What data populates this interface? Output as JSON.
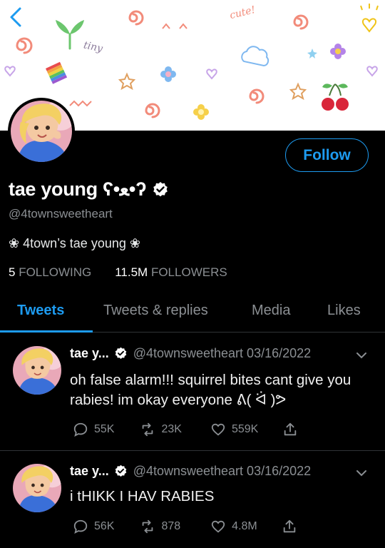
{
  "banner": {
    "doodle_words": [
      "tiny",
      "cute!",
      "^ ^"
    ]
  },
  "profile": {
    "display_name": "tae young ʕ•ﻌ•ʔ",
    "handle": "@4townsweetheart",
    "bio": "❀ 4town’s tae young ❀",
    "following_count": "5",
    "following_label": "FOLLOWING",
    "followers_count": "11.5M",
    "followers_label": "FOLLOWERS",
    "follow_label": "Follow"
  },
  "tabs": [
    {
      "label": "Tweets",
      "active": true
    },
    {
      "label": "Tweets & replies",
      "active": false
    },
    {
      "label": "Media",
      "active": false
    },
    {
      "label": "Likes",
      "active": false
    }
  ],
  "tweets": [
    {
      "name": "tae y...",
      "handle_date": "@4townsweetheart 03/16/2022",
      "text": "oh false alarm!!! squirrel bites cant give you rabies! im okay everyone ᕕ( ᐛ )ᕗ",
      "replies": "55K",
      "retweets": "23K",
      "likes": "559K"
    },
    {
      "name": "tae y...",
      "handle_date": "@4townsweetheart 03/16/2022",
      "text": "i tHIKK I HAV RABIES",
      "replies": "56K",
      "retweets": "878",
      "likes": "4.8M"
    }
  ],
  "colors": {
    "accent": "#1d9bf0",
    "muted": "#8b8f93",
    "background": "#000000"
  }
}
